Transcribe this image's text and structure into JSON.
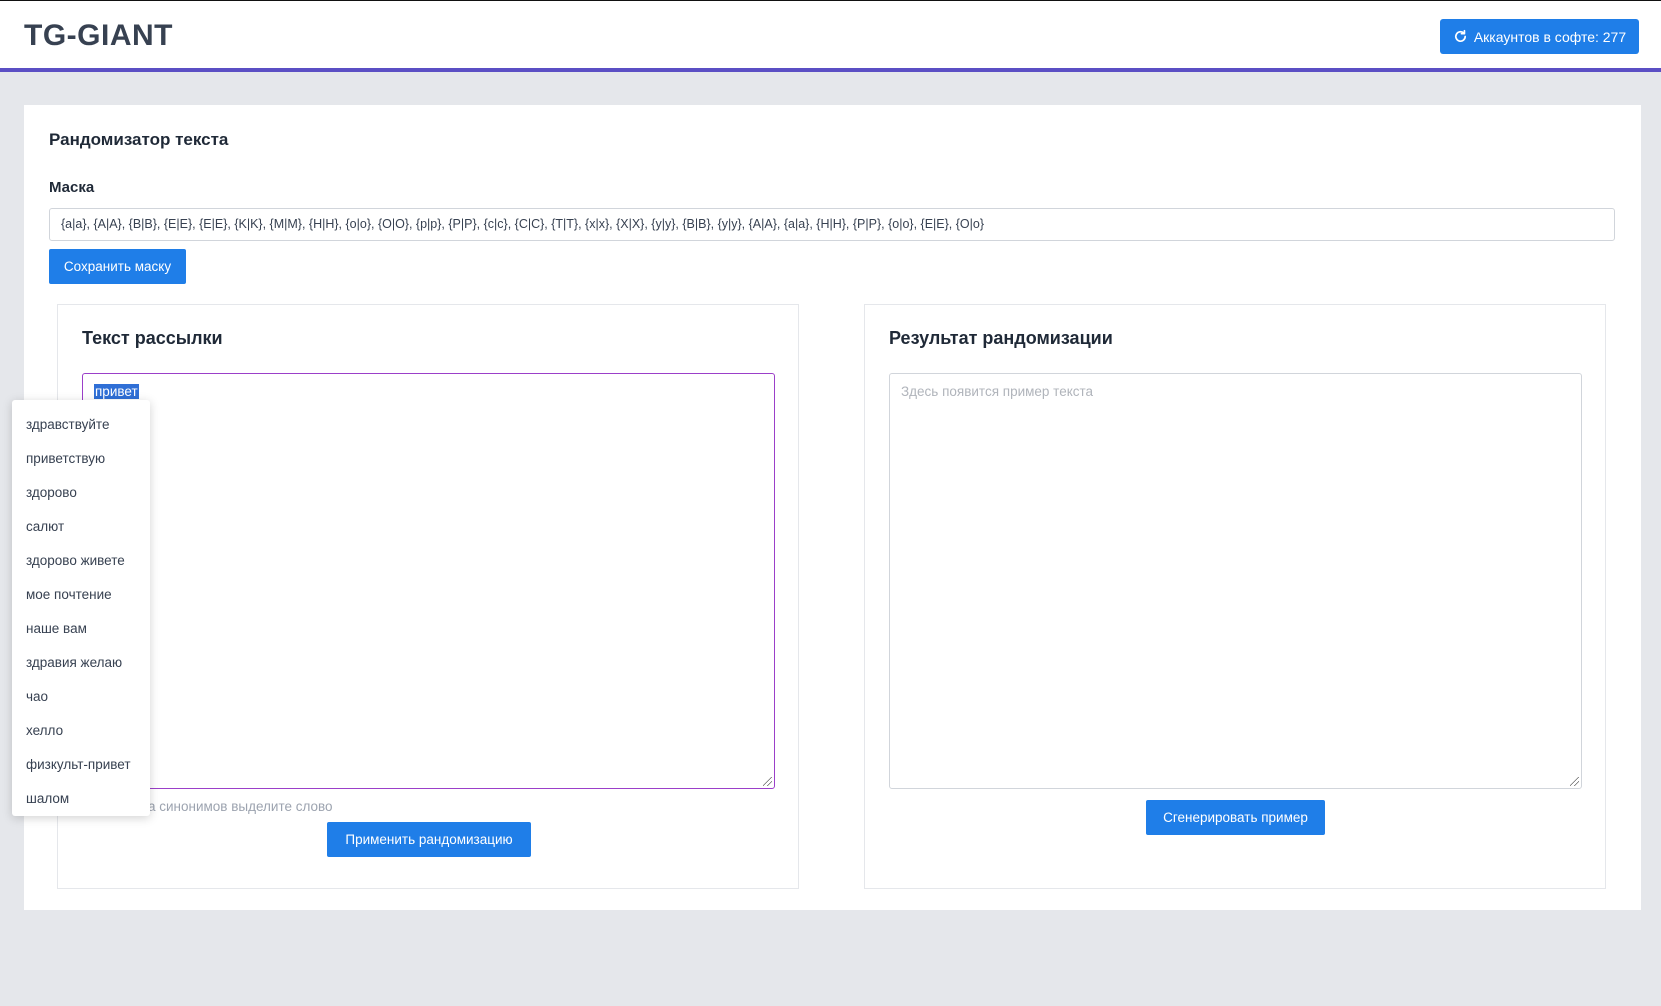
{
  "app": {
    "logo": "TG-GIANT",
    "accounts_button": "Аккаунтов в софте: 277"
  },
  "randomizer": {
    "title": "Рандомизатор текста",
    "mask_label": "Маска",
    "mask_value": "{a|a}, {A|A}, {B|B}, {E|E}, {E|E}, {K|K}, {M|M}, {H|H}, {o|o}, {O|O}, {p|p}, {P|P}, {c|c}, {C|C}, {T|T}, {x|x}, {X|X}, {y|y}, {B|B}, {y|y}, {A|A}, {a|a}, {H|H}, {P|P}, {o|o}, {E|E}, {O|o}",
    "save_mask_button": "Сохранить маску"
  },
  "left_panel": {
    "title": "Текст рассылки",
    "text": "привет",
    "hint": "Для вызова синонимов выделите слово",
    "hint_visible": "а синонимов выделите слово",
    "apply_button": "Применить рандомизацию"
  },
  "right_panel": {
    "title": "Результат рандомизации",
    "placeholder": "Здесь появится пример текста",
    "generate_button": "Сгенерировать пример"
  },
  "synonyms": [
    "здравствуйте",
    "приветствую",
    "здорово",
    "салют",
    "здорово живете",
    "мое почтение",
    "наше вам",
    "здравия желаю",
    "чао",
    "хелло",
    "физкульт-привет",
    "шалом"
  ],
  "colors": {
    "accent": "#1f7ee8",
    "header_border": "#5b4fc4",
    "focus_border": "#9b3fc9",
    "background": "#e5e7eb"
  }
}
